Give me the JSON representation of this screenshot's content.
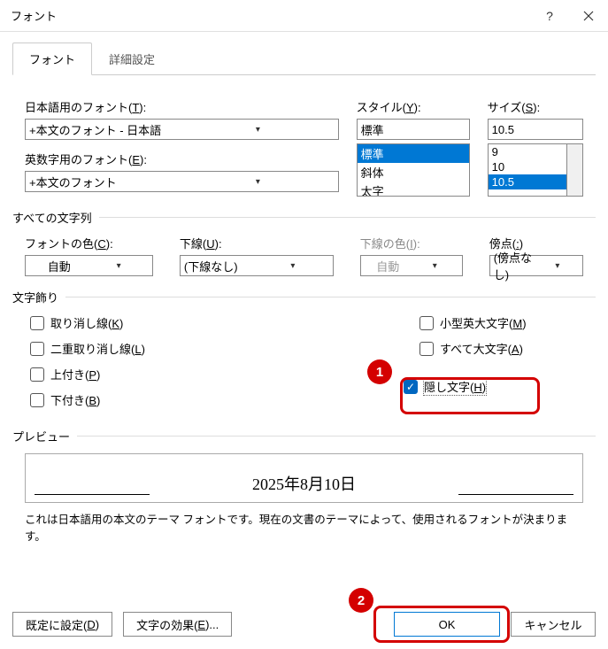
{
  "titlebar": {
    "title": "フォント"
  },
  "tabs": {
    "font": "フォント",
    "advanced": "詳細設定"
  },
  "fonts": {
    "jp_label": "日本語用のフォント(T):",
    "jp_label_pre": "日本語用のフォント(",
    "jp_label_key": "T",
    "jp_label_post": "):",
    "jp_value": "+本文のフォント - 日本語",
    "latin_label_pre": "英数字用のフォント(",
    "latin_label_key": "E",
    "latin_label_post": "):",
    "latin_value": "+本文のフォント",
    "style_label_pre": "スタイル(",
    "style_label_key": "Y",
    "style_label_post": "):",
    "style_value": "標準",
    "style_options": [
      "標準",
      "斜体",
      "太字"
    ],
    "size_label_pre": "サイズ(",
    "size_label_key": "S",
    "size_label_post": "):",
    "size_value": "10.5",
    "size_options": [
      "9",
      "10",
      "10.5"
    ]
  },
  "allchars": {
    "group": "すべての文字列",
    "color_label_pre": "フォントの色(",
    "color_label_key": "C",
    "color_label_post": "):",
    "color_value": "自動",
    "underline_label_pre": "下線(",
    "underline_label_key": "U",
    "underline_label_post": "):",
    "underline_value": "(下線なし)",
    "ucolor_label_pre": "下線の色(",
    "ucolor_label_key": "I",
    "ucolor_label_post": "):",
    "ucolor_value": "自動",
    "em_label_pre": "傍点(",
    "em_label_key": ":",
    "em_label_post": ")",
    "em_value": "(傍点なし)"
  },
  "effects": {
    "group": "文字飾り",
    "strike_pre": "取り消し線(",
    "strike_key": "K",
    "strike_post": ")",
    "dstrike_pre": "二重取り消し線(",
    "dstrike_key": "L",
    "dstrike_post": ")",
    "super_pre": "上付き(",
    "super_key": "P",
    "super_post": ")",
    "sub_pre": "下付き(",
    "sub_key": "B",
    "sub_post": ")",
    "smallcaps_pre": "小型英大文字(",
    "smallcaps_key": "M",
    "smallcaps_post": ")",
    "allcaps_pre": "すべて大文字(",
    "allcaps_key": "A",
    "allcaps_post": ")",
    "hidden_pre": "隠し文字(",
    "hidden_key": "H",
    "hidden_post": ")"
  },
  "preview": {
    "group": "プレビュー",
    "text": "2025年8月10日",
    "note": "これは日本語用の本文のテーマ フォントです。現在の文書のテーマによって、使用されるフォントが決まります。"
  },
  "buttons": {
    "set_default_pre": "既定に設定(",
    "set_default_key": "D",
    "set_default_post": ")",
    "text_effects_pre": "文字の効果(",
    "text_effects_key": "E",
    "text_effects_post": ")...",
    "ok": "OK",
    "cancel": "キャンセル"
  },
  "callouts": {
    "c1": "1",
    "c2": "2"
  }
}
